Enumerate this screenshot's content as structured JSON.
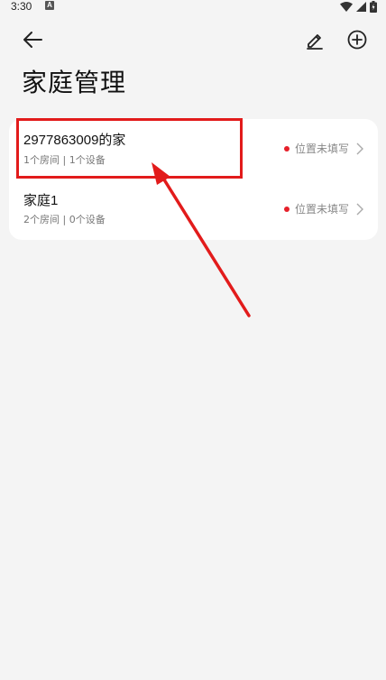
{
  "status_bar": {
    "time": "3:30",
    "notification_letter": "A"
  },
  "app_bar": {
    "back_icon": "arrow-left-icon",
    "edit_icon": "pencil-icon",
    "add_icon": "plus-circle-icon"
  },
  "page": {
    "title": "家庭管理"
  },
  "homes": [
    {
      "name": "2977863009的家",
      "summary": "1个房间 | 1个设备",
      "location_status": "位置未填写"
    },
    {
      "name": "家庭1",
      "summary": "2个房间 | 0个设备",
      "location_status": "位置未填写"
    }
  ],
  "colors": {
    "background": "#f4f4f4",
    "card": "#ffffff",
    "status_dot": "#e6202a",
    "annotation": "#e21b1b"
  }
}
